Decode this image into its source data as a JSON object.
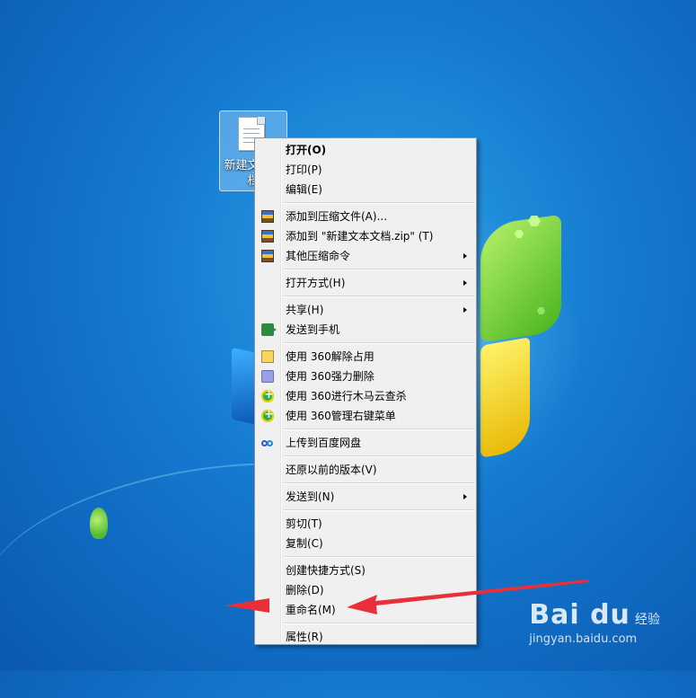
{
  "desktop": {
    "icon_label": "新建文本文档"
  },
  "context_menu": {
    "groups": [
      [
        {
          "label": "打开(O)",
          "bold": true,
          "icon": null,
          "submenu": false
        },
        {
          "label": "打印(P)",
          "icon": null,
          "submenu": false
        },
        {
          "label": "编辑(E)",
          "icon": null,
          "submenu": false
        }
      ],
      [
        {
          "label": "添加到压缩文件(A)...",
          "icon": "winrar-icon",
          "submenu": false
        },
        {
          "label": "添加到 \"新建文本文档.zip\" (T)",
          "icon": "winrar-icon",
          "submenu": false
        },
        {
          "label": "其他压缩命令",
          "icon": "winrar-icon",
          "submenu": true
        }
      ],
      [
        {
          "label": "打开方式(H)",
          "icon": null,
          "submenu": true
        }
      ],
      [
        {
          "label": "共享(H)",
          "icon": null,
          "submenu": true
        },
        {
          "label": "发送到手机",
          "icon": "send-to-phone-icon",
          "submenu": false
        }
      ],
      [
        {
          "label": "使用 360解除占用",
          "icon": "360-unlock-icon",
          "submenu": false
        },
        {
          "label": "使用 360强力删除",
          "icon": "360-shred-icon",
          "submenu": false
        },
        {
          "label": "使用 360进行木马云查杀",
          "icon": "360-scan-icon",
          "submenu": false
        },
        {
          "label": "使用 360管理右键菜单",
          "icon": "360-manage-icon",
          "submenu": false
        }
      ],
      [
        {
          "label": "上传到百度网盘",
          "icon": "baidu-netdisk-icon",
          "submenu": false
        }
      ],
      [
        {
          "label": "还原以前的版本(V)",
          "icon": null,
          "submenu": false
        }
      ],
      [
        {
          "label": "发送到(N)",
          "icon": null,
          "submenu": true
        }
      ],
      [
        {
          "label": "剪切(T)",
          "icon": null,
          "submenu": false
        },
        {
          "label": "复制(C)",
          "icon": null,
          "submenu": false
        }
      ],
      [
        {
          "label": "创建快捷方式(S)",
          "icon": null,
          "submenu": false
        },
        {
          "label": "删除(D)",
          "icon": null,
          "submenu": false
        },
        {
          "label": "重命名(M)",
          "icon": null,
          "submenu": false
        }
      ],
      [
        {
          "label": "属性(R)",
          "icon": null,
          "submenu": false
        }
      ]
    ]
  },
  "colors": {
    "annotation_arrow": "#e8303a"
  },
  "watermark": {
    "logo": "Bai du",
    "suffix": "经验",
    "url": "jingyan.baidu.com"
  }
}
